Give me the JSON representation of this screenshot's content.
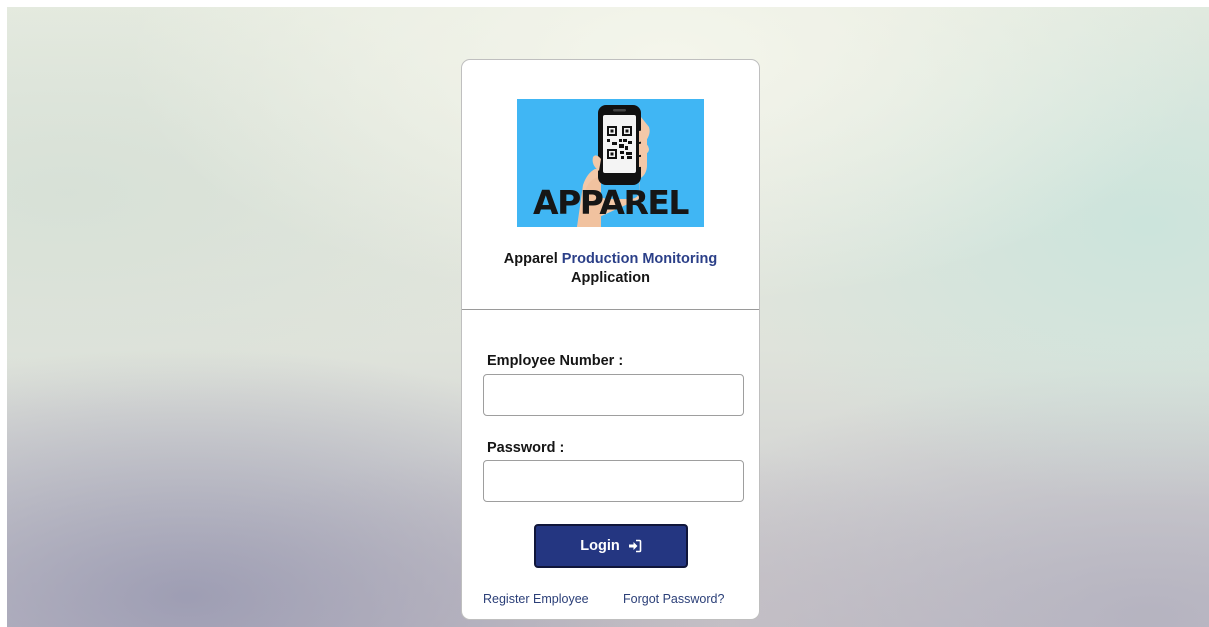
{
  "logo": {
    "text": "APPAREL",
    "icon": "qr-phone-icon",
    "background": "#40b6f4"
  },
  "app_title": {
    "part1": "Apparel ",
    "part2": "Production Monitoring",
    "part3": "Application",
    "accent_color": "#2b3f88"
  },
  "form": {
    "employee_label": "Employee Number :",
    "employee_value": "",
    "employee_placeholder": "",
    "password_label": "Password :",
    "password_value": "",
    "password_placeholder": "",
    "login_label": "Login",
    "login_icon": "sign-in-icon",
    "login_color": "#243681"
  },
  "links": {
    "register": "Register Employee",
    "forgot": "Forgot Password?"
  }
}
